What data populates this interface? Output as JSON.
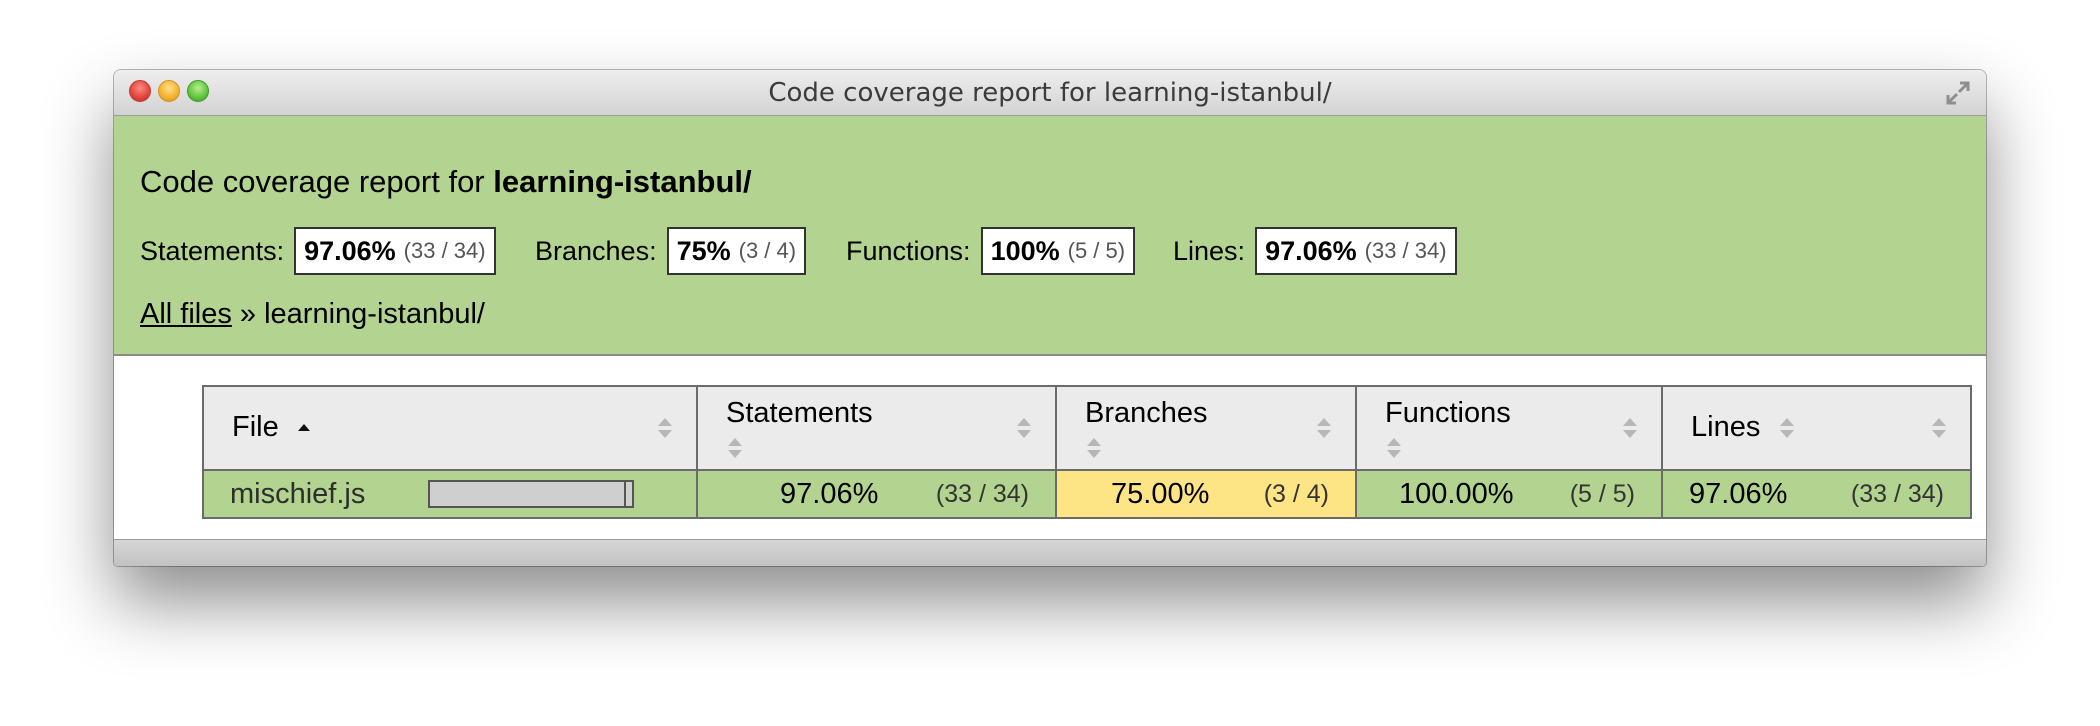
{
  "window": {
    "title": "Code coverage report for learning-istanbul/"
  },
  "header": {
    "title_prefix": "Code coverage report for ",
    "title_path": "learning-istanbul/",
    "metrics": [
      {
        "label": "Statements:",
        "pct": "97.06%",
        "frac": "(33 / 34)"
      },
      {
        "label": "Branches:",
        "pct": "75%",
        "frac": "(3 / 4)"
      },
      {
        "label": "Functions:",
        "pct": "100%",
        "frac": "(5 / 5)"
      },
      {
        "label": "Lines:",
        "pct": "97.06%",
        "frac": "(33 / 34)"
      }
    ],
    "breadcrumb": {
      "link": "All files",
      "separator": " » ",
      "current": "learning-istanbul/"
    }
  },
  "table": {
    "columns": [
      "File",
      "Statements",
      "Branches",
      "Functions",
      "Lines"
    ],
    "rows": [
      {
        "file": "mischief.js",
        "coverage_fraction": 0.9706,
        "statements": {
          "pct": "97.06%",
          "frac": "(33 / 34)"
        },
        "branches": {
          "pct": "75.00%",
          "frac": "(3 / 4)"
        },
        "functions": {
          "pct": "100.00%",
          "frac": "(5 / 5)"
        },
        "lines": {
          "pct": "97.06%",
          "frac": "(33 / 34)"
        }
      }
    ]
  },
  "colors": {
    "high": "#b3d491",
    "medium": "#fde585",
    "header_bg": "#ebebeb"
  },
  "icons": {
    "close": "close-icon",
    "minimize": "minimize-icon",
    "zoom": "zoom-icon",
    "fullscreen": "fullscreen-icon",
    "sort_asc": "sort-ascending-icon",
    "sort": "sort-icon"
  }
}
